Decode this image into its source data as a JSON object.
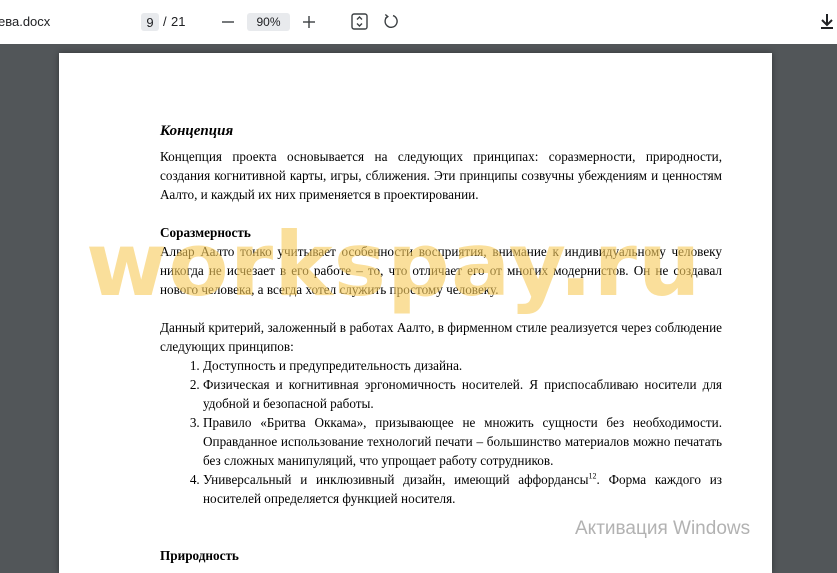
{
  "toolbar": {
    "file_title": "ева.docx",
    "page_current": "9",
    "page_separator": "/",
    "page_total": "21",
    "zoom_level": "90%",
    "icons": [
      "zoom-out-icon",
      "zoom-in-icon",
      "fit-page-icon",
      "rotate-icon",
      "download-icon"
    ]
  },
  "document": {
    "heading": "Концепция",
    "intro": "Концепция проекта основывается на следующих принципах: соразмерности, природности, создания когнитивной карты, игры, сближения. Эти принципы созвучны убеждениям и ценностям Аалто, и каждый их них применяется в проектировании.",
    "section1_title": "Соразмерность",
    "section1_text": "Алвар Аалто тонко учитывает особенности восприятия, внимание к индивидуальному человеку никогда не исчезает в его работе – то, что отличает его от многих модернистов. Он не создавал нового человека, а всегда хотел служить простому человеку.",
    "criteria_text": "Данный критерий, заложенный в работах Аалто, в фирменном стиле реализуется через соблюдение следующих принципов:",
    "list": [
      "Доступность и предупредительность дизайна.",
      "Физическая и когнитивная эргономичность носителей. Я приспосабливаю носители для удобной и безопасной работы.",
      "Правило «Бритва Оккама», призывающее не множить сущности без необходимости. Оправданное использование технологий печати – большинство материалов можно печатать без сложных манипуляций, что упрощает работу сотрудников."
    ],
    "list_item4_pre": "Универсальный и инклюзивный дизайн, имеющий аффордансы",
    "list_item4_sup": "12",
    "list_item4_post": ". Форма каждого из носителей определяется функцией носителя.",
    "section2_title": "Природность"
  },
  "overlays": {
    "watermark": "workspay.ru",
    "activation": "Активация Windows"
  }
}
